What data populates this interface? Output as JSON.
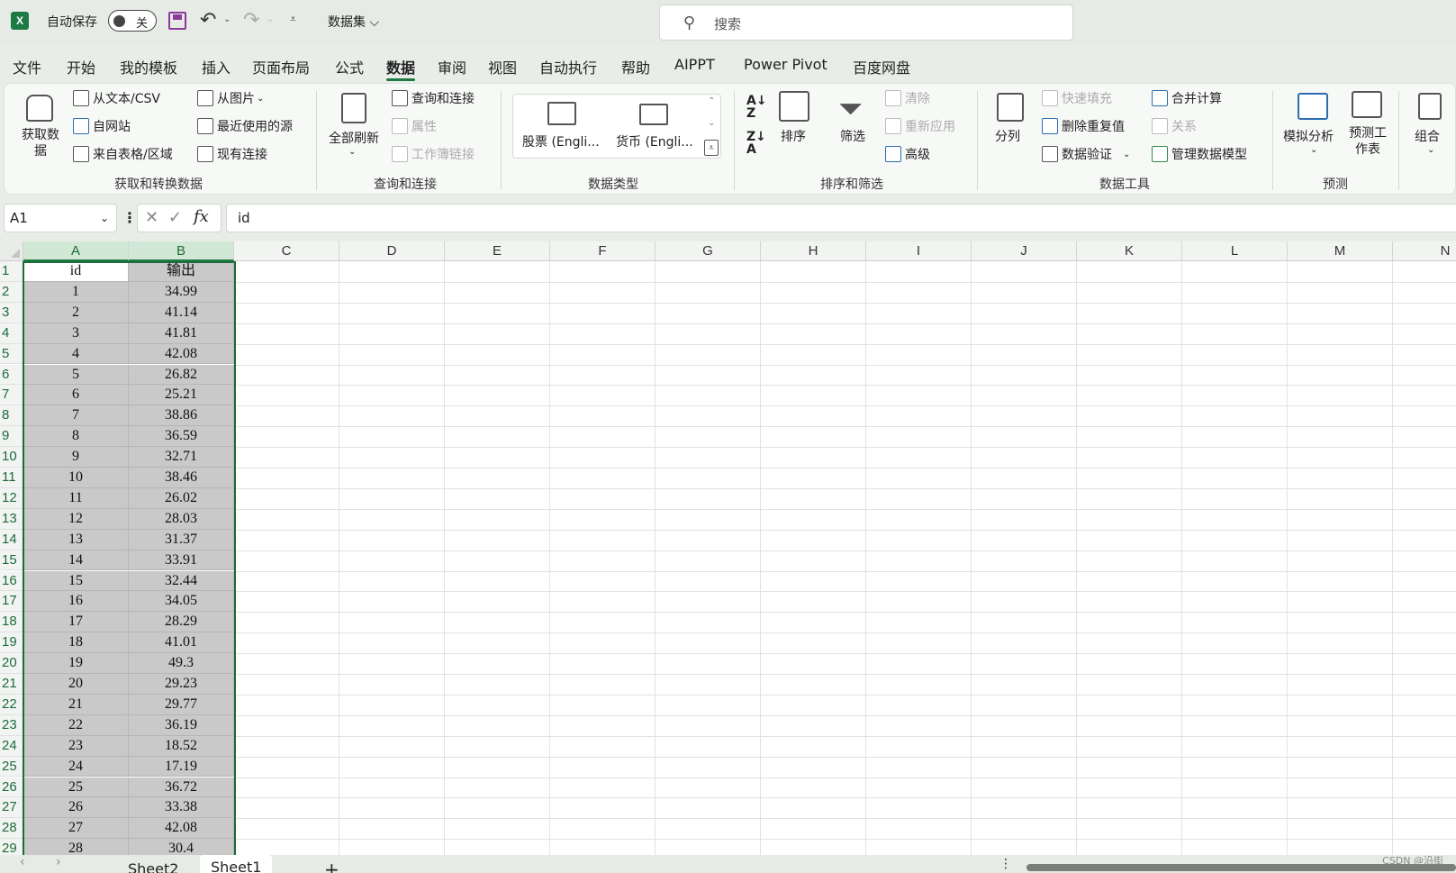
{
  "titlebar": {
    "autosave_label": "自动保存",
    "autosave_state": "关",
    "file_name": "数据集 ⌵",
    "search_placeholder": "搜索"
  },
  "menu": {
    "tabs": [
      "文件",
      "开始",
      "我的模板",
      "插入",
      "页面布局",
      "公式",
      "数据",
      "审阅",
      "视图",
      "自动执行",
      "帮助",
      "AIPPT",
      "Power Pivot",
      "百度网盘"
    ],
    "active": "数据"
  },
  "ribbon": {
    "get_data": {
      "big_button": "获取数据",
      "from_text_csv": "从文本/CSV",
      "from_web": "自网站",
      "from_table": "来自表格/区域",
      "from_picture": "从图片",
      "recent_sources": "最近使用的源",
      "existing_connections": "现有连接",
      "group_label": "获取和转换数据"
    },
    "queries": {
      "refresh_all": "全部刷新",
      "queries_connections": "查询和连接",
      "properties": "属性",
      "workbook_links": "工作簿链接",
      "group_label": "查询和连接"
    },
    "data_types": {
      "stocks": "股票 (Engli...",
      "currency": "货币 (Engli...",
      "group_label": "数据类型"
    },
    "sort_filter": {
      "sort": "排序",
      "filter": "筛选",
      "clear": "清除",
      "reapply": "重新应用",
      "advanced": "高级",
      "group_label": "排序和筛选"
    },
    "data_tools": {
      "text_to_columns": "分列",
      "flash_fill": "快速填充",
      "remove_duplicates": "删除重复值",
      "data_validation": "数据验证",
      "consolidate": "合并计算",
      "relationships": "关系",
      "manage_model": "管理数据模型",
      "group_label": "数据工具"
    },
    "forecast": {
      "what_if": "模拟分析",
      "forecast_sheet": "预测工作表",
      "group_label": "预测"
    },
    "outline": {
      "group": "组合"
    }
  },
  "formula_bar": {
    "name_box": "A1",
    "fx": "fx",
    "content": "id"
  },
  "grid": {
    "columns": [
      "A",
      "B",
      "C",
      "D",
      "E",
      "F",
      "G",
      "H",
      "I",
      "J",
      "K",
      "L",
      "M",
      "N"
    ],
    "rows": [
      {
        "n": "1",
        "a": "id",
        "b": "输出"
      },
      {
        "n": "2",
        "a": "1",
        "b": "34.99"
      },
      {
        "n": "3",
        "a": "2",
        "b": "41.14"
      },
      {
        "n": "4",
        "a": "3",
        "b": "41.81"
      },
      {
        "n": "5",
        "a": "4",
        "b": "42.08"
      },
      {
        "n": "6",
        "a": "5",
        "b": "26.82"
      },
      {
        "n": "7",
        "a": "6",
        "b": "25.21"
      },
      {
        "n": "8",
        "a": "7",
        "b": "38.86"
      },
      {
        "n": "9",
        "a": "8",
        "b": "36.59"
      },
      {
        "n": "10",
        "a": "9",
        "b": "32.71"
      },
      {
        "n": "11",
        "a": "10",
        "b": "38.46"
      },
      {
        "n": "12",
        "a": "11",
        "b": "26.02"
      },
      {
        "n": "13",
        "a": "12",
        "b": "28.03"
      },
      {
        "n": "14",
        "a": "13",
        "b": "31.37"
      },
      {
        "n": "15",
        "a": "14",
        "b": "33.91"
      },
      {
        "n": "16",
        "a": "15",
        "b": "32.44"
      },
      {
        "n": "17",
        "a": "16",
        "b": "34.05"
      },
      {
        "n": "18",
        "a": "17",
        "b": "28.29"
      },
      {
        "n": "19",
        "a": "18",
        "b": "41.01"
      },
      {
        "n": "20",
        "a": "19",
        "b": "49.3"
      },
      {
        "n": "21",
        "a": "20",
        "b": "29.23"
      },
      {
        "n": "22",
        "a": "21",
        "b": "29.77"
      },
      {
        "n": "23",
        "a": "22",
        "b": "36.19"
      },
      {
        "n": "24",
        "a": "23",
        "b": "18.52"
      },
      {
        "n": "25",
        "a": "24",
        "b": "17.19"
      },
      {
        "n": "26",
        "a": "25",
        "b": "36.72"
      },
      {
        "n": "27",
        "a": "26",
        "b": "33.38"
      },
      {
        "n": "28",
        "a": "27",
        "b": "42.08"
      },
      {
        "n": "29",
        "a": "28",
        "b": "30.4"
      }
    ]
  },
  "sheets": {
    "tabs": [
      "Sheet2",
      "Sheet1"
    ],
    "active": "Sheet1",
    "add": "+"
  },
  "watermark": "CSDN @沿街",
  "colors": {
    "accent": "#1d7a43",
    "selection_fill": "#c9c9c9"
  }
}
